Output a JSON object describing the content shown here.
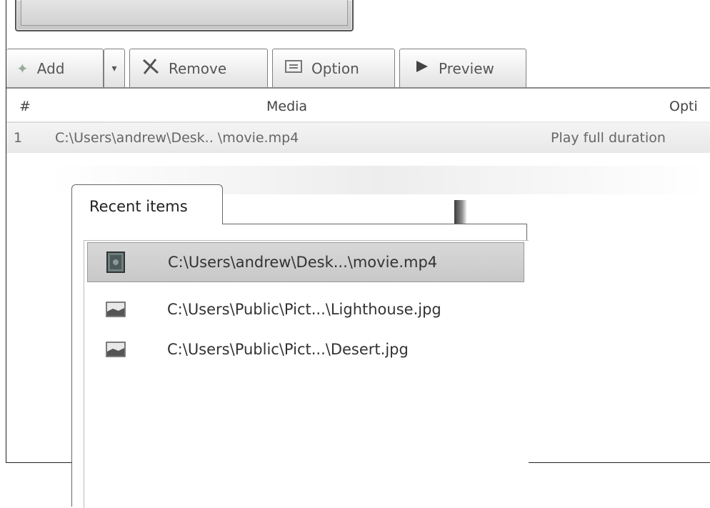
{
  "toolbar": {
    "add_label": "Add",
    "dropdown_glyph": "▾",
    "remove_label": "Remove",
    "option_label": "Option",
    "preview_label": "Preview"
  },
  "table": {
    "columns": [
      "#",
      "Media",
      "Opti"
    ],
    "rows": [
      {
        "index": "1",
        "media": "C:\\Users\\andrew\\Desk.. \\movie.mp4",
        "option": "Play full duration"
      }
    ]
  },
  "recent": {
    "tab_label": "Recent items",
    "items": [
      {
        "path": "C:\\Users\\andrew\\Desk...\\movie.mp4",
        "icon": "video-file-icon",
        "selected": true
      },
      {
        "path": "C:\\Users\\Public\\Pict...\\Lighthouse.jpg",
        "icon": "image-file-icon",
        "selected": false
      },
      {
        "path": "C:\\Users\\Public\\Pict...\\Desert.jpg",
        "icon": "image-file-icon",
        "selected": false
      }
    ]
  },
  "colors": {
    "selection": "#cfcfcf",
    "border": "#666666",
    "text": "#333333"
  }
}
